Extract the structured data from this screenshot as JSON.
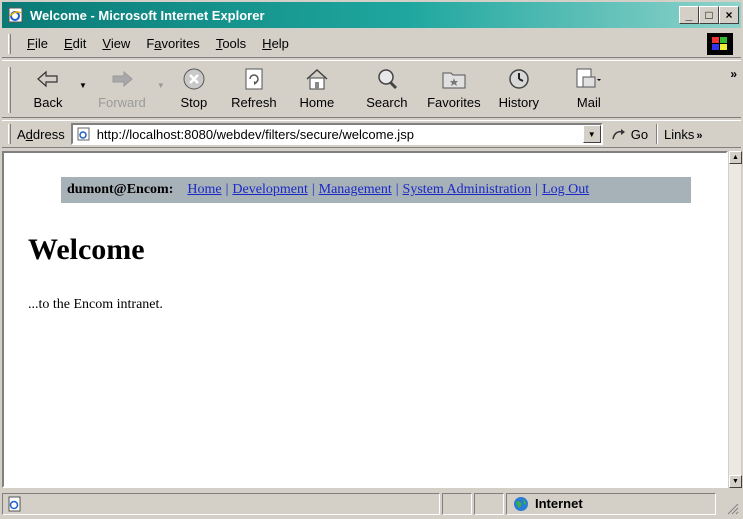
{
  "window": {
    "title": "Welcome - Microsoft Internet Explorer",
    "controls": {
      "minimize": "_",
      "maximize": "□",
      "close": "×"
    }
  },
  "menu": {
    "items": [
      {
        "label": "File",
        "key": "F",
        "rest": "ile"
      },
      {
        "label": "Edit",
        "key": "E",
        "rest": "dit"
      },
      {
        "label": "View",
        "key": "V",
        "rest": "iew"
      },
      {
        "label": "Favorites",
        "pre": "F",
        "key": "a",
        "rest": "vorites"
      },
      {
        "label": "Tools",
        "key": "T",
        "rest": "ools"
      },
      {
        "label": "Help",
        "key": "H",
        "rest": "elp"
      }
    ]
  },
  "toolbar": {
    "back": "Back",
    "forward": "Forward",
    "stop": "Stop",
    "refresh": "Refresh",
    "home": "Home",
    "search": "Search",
    "favorites": "Favorites",
    "history": "History",
    "mail": "Mail",
    "more": "»"
  },
  "address": {
    "label_pre": "A",
    "label_key": "d",
    "label_rest": "dress",
    "url": "http://localhost:8080/webdev/filters/secure/welcome.jsp",
    "go": "Go",
    "links": "Links",
    "links_more": "»"
  },
  "page": {
    "user": "dumont@Encom:",
    "nav": [
      "Home",
      "Development",
      "Management",
      "System Administration",
      "Log Out"
    ],
    "nav_sep": "|",
    "heading": "Welcome",
    "body": "...to the Encom intranet."
  },
  "status": {
    "zone": "Internet"
  },
  "colors": {
    "title_gradient_start": "#0a7a76",
    "title_gradient_end": "#8fd3cb",
    "nav_background": "#a7b1b8",
    "link": "#1a28c7",
    "chrome": "#d4d0c8"
  }
}
